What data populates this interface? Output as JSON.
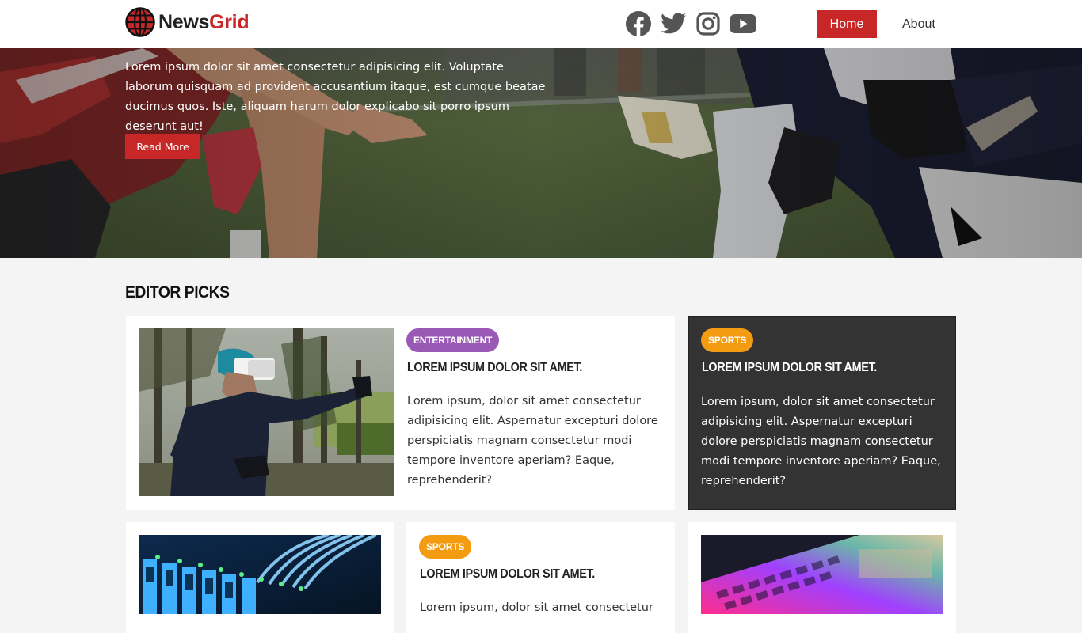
{
  "header": {
    "logo_part1": "News",
    "logo_part2": "Grid",
    "social_icons": [
      "facebook-icon",
      "twitter-icon",
      "instagram-icon",
      "youtube-icon"
    ],
    "nav": {
      "home": "Home",
      "about": "About"
    }
  },
  "hero": {
    "text": "Lorem ipsum dolor sit amet consectetur adipisicing elit. Voluptate laborum quisquam ad provident accusantium itaque, est cumque beatae ducimus quos. Iste, aliquam harum dolor explicabo sit porro ipsum deserunt aut!",
    "button": "Read More"
  },
  "editor_picks": {
    "title": "EDITOR PICKS",
    "featured": {
      "category": "ENTERTAINMENT",
      "title": "LOREM IPSUM DOLOR SIT AMET.",
      "body": "Lorem ipsum, dolor sit amet consectetur adipisicing elit. Aspernatur excepturi dolore perspiciatis magnam consectetur modi tempore inventore aperiam? Eaque, reprehenderit?"
    },
    "side": {
      "category": "SPORTS",
      "title": "LOREM IPSUM DOLOR SIT AMET.",
      "body": "Lorem ipsum, dolor sit amet consectetur adipisicing elit. Aspernatur excepturi dolore perspiciatis magnam consectetur modi tempore inventore aperiam? Eaque, reprehenderit?"
    },
    "row2_middle": {
      "category": "SPORTS",
      "title": "LOREM IPSUM DOLOR SIT AMET.",
      "body": "Lorem ipsum, dolor sit amet consectetur"
    }
  },
  "colors": {
    "brand_red": "#c72727",
    "entertainment": "#9b59b6",
    "sports": "#f39c12",
    "dark_card": "#333333",
    "icon_gray": "#555555"
  }
}
